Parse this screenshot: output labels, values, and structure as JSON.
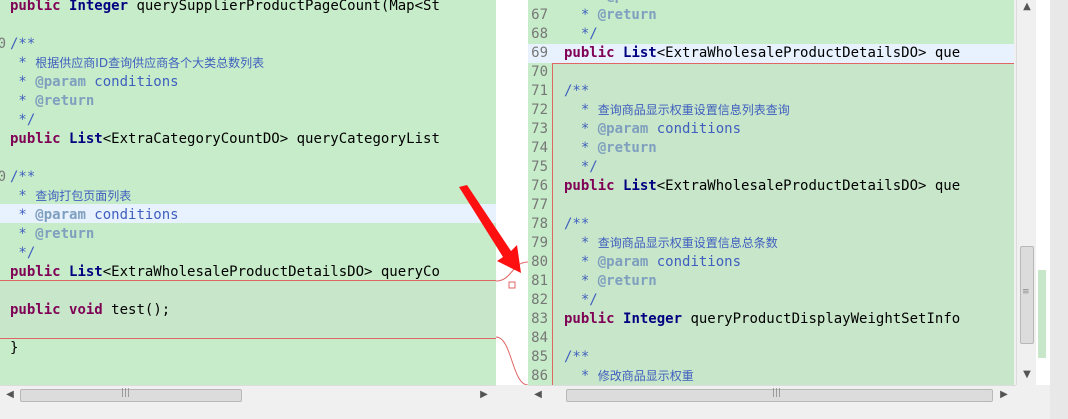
{
  "left": {
    "lines": [
      {
        "num": "",
        "parts": [
          [
            "kw",
            "public "
          ],
          [
            "type",
            "Integer "
          ],
          [
            "b",
            "querySupplierProductPageCount(Map<St"
          ]
        ]
      },
      {
        "num": "",
        "parts": []
      },
      {
        "num": "0",
        "parts": [
          [
            "cm",
            "/**"
          ]
        ]
      },
      {
        "num": "",
        "parts": [
          [
            "cm",
            " * "
          ],
          [
            "cmcn",
            "根据供应商ID查询供应商各个大类总数列表"
          ]
        ]
      },
      {
        "num": "",
        "parts": [
          [
            "cm",
            " * "
          ],
          [
            "tag",
            "@param"
          ],
          [
            "cm",
            " conditions"
          ]
        ]
      },
      {
        "num": "",
        "parts": [
          [
            "cm",
            " * "
          ],
          [
            "tag",
            "@return"
          ]
        ]
      },
      {
        "num": "",
        "parts": [
          [
            "cm",
            " */"
          ]
        ]
      },
      {
        "num": "",
        "parts": [
          [
            "kw",
            "public "
          ],
          [
            "type",
            "List"
          ],
          [
            "b",
            "<ExtraCategoryCountDO> queryCategoryList"
          ]
        ]
      },
      {
        "num": "",
        "parts": []
      },
      {
        "num": "0",
        "parts": [
          [
            "cm",
            "/**"
          ]
        ]
      },
      {
        "num": "",
        "parts": [
          [
            "cm",
            " * "
          ],
          [
            "cmcn",
            "查询打包页面列表"
          ]
        ]
      },
      {
        "num": "",
        "parts": [
          [
            "cm",
            " * "
          ],
          [
            "tag",
            "@param"
          ],
          [
            "cm",
            " conditions"
          ]
        ]
      },
      {
        "num": "",
        "parts": [
          [
            "cm",
            " * "
          ],
          [
            "tag",
            "@return"
          ]
        ]
      },
      {
        "num": "",
        "parts": [
          [
            "cm",
            " */"
          ]
        ]
      },
      {
        "num": "",
        "parts": [
          [
            "kw",
            "public "
          ],
          [
            "type",
            "List"
          ],
          [
            "b",
            "<ExtraWholesaleProductDetailsDO> queryCo"
          ]
        ]
      },
      {
        "num": "",
        "parts": []
      },
      {
        "num": "",
        "parts": [
          [
            "kw",
            "public "
          ],
          [
            "kw",
            "void "
          ],
          [
            "b",
            "test();"
          ]
        ]
      },
      {
        "num": "",
        "parts": []
      },
      {
        "num": "",
        "parts": [
          [
            "plain",
            "}"
          ]
        ]
      },
      {
        "num": "",
        "parts": []
      }
    ]
  },
  "right": {
    "lines": [
      {
        "num": "",
        "parts": [
          [
            "cm",
            "     "
          ],
          [
            "tag",
            "@param"
          ],
          [
            "cm",
            " conditions"
          ]
        ]
      },
      {
        "num": "67",
        "parts": [
          [
            "cm",
            "  * "
          ],
          [
            "tag",
            "@return"
          ]
        ]
      },
      {
        "num": "68",
        "parts": [
          [
            "cm",
            "  */"
          ]
        ]
      },
      {
        "num": "69",
        "parts": [
          [
            "kw",
            "public "
          ],
          [
            "type",
            "List"
          ],
          [
            "b",
            "<ExtraWholesaleProductDetailsDO> que"
          ]
        ]
      },
      {
        "num": "70",
        "parts": []
      },
      {
        "num": "71",
        "parts": [
          [
            "cm",
            "/**"
          ]
        ]
      },
      {
        "num": "72",
        "parts": [
          [
            "cm",
            "  * "
          ],
          [
            "cmcn",
            "查询商品显示权重设置信息列表查询"
          ]
        ]
      },
      {
        "num": "73",
        "parts": [
          [
            "cm",
            "  * "
          ],
          [
            "tag",
            "@param"
          ],
          [
            "cm",
            " conditions"
          ]
        ]
      },
      {
        "num": "74",
        "parts": [
          [
            "cm",
            "  * "
          ],
          [
            "tag",
            "@return"
          ]
        ]
      },
      {
        "num": "75",
        "parts": [
          [
            "cm",
            "  */"
          ]
        ]
      },
      {
        "num": "76",
        "parts": [
          [
            "kw",
            "public "
          ],
          [
            "type",
            "List"
          ],
          [
            "b",
            "<ExtraWholesaleProductDetailsDO> que"
          ]
        ]
      },
      {
        "num": "77",
        "parts": []
      },
      {
        "num": "78",
        "parts": [
          [
            "cm",
            "/**"
          ]
        ]
      },
      {
        "num": "79",
        "parts": [
          [
            "cm",
            "  * "
          ],
          [
            "cmcn",
            "查询商品显示权重设置信息总条数"
          ]
        ]
      },
      {
        "num": "80",
        "parts": [
          [
            "cm",
            "  * "
          ],
          [
            "tag",
            "@param"
          ],
          [
            "cm",
            " conditions"
          ]
        ]
      },
      {
        "num": "81",
        "parts": [
          [
            "cm",
            "  * "
          ],
          [
            "tag",
            "@return"
          ]
        ]
      },
      {
        "num": "82",
        "parts": [
          [
            "cm",
            "  */"
          ]
        ]
      },
      {
        "num": "83",
        "parts": [
          [
            "kw",
            "public "
          ],
          [
            "type",
            "Integer "
          ],
          [
            "b",
            "queryProductDisplayWeightSetInfo"
          ]
        ]
      },
      {
        "num": "84",
        "parts": []
      },
      {
        "num": "85",
        "parts": [
          [
            "cm",
            "/**"
          ]
        ]
      },
      {
        "num": "86",
        "parts": [
          [
            "cm",
            "  * "
          ],
          [
            "cmcn",
            "修改商品显示权重"
          ]
        ]
      }
    ]
  },
  "scrollbars": {
    "left_arrow": "◀",
    "right_arrow": "▶",
    "up_arrow": "▲",
    "down_arrow": "▼",
    "grip": "|||"
  }
}
